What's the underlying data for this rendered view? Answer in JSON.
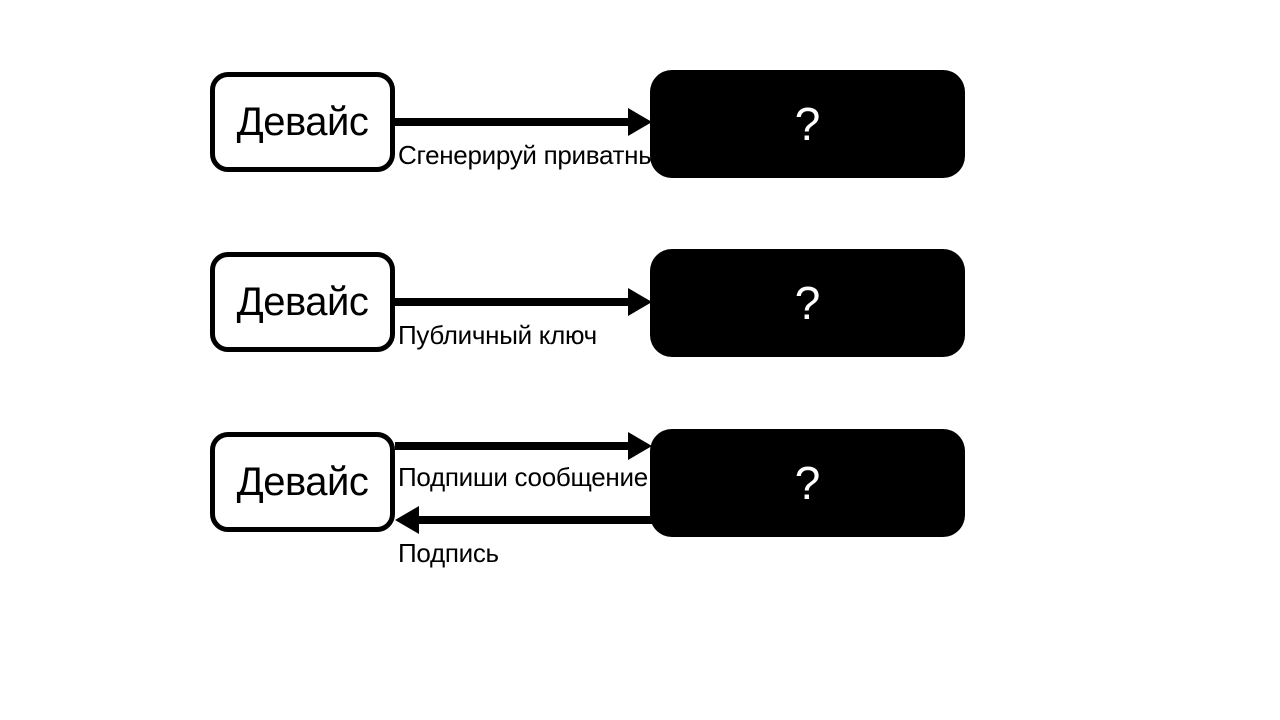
{
  "rows": [
    {
      "device_label": "Девайс",
      "mystery_label": "?",
      "arrows": [
        {
          "direction": "right",
          "caption": "Сгенерируй приватный ключ"
        }
      ]
    },
    {
      "device_label": "Девайс",
      "mystery_label": "?",
      "arrows": [
        {
          "direction": "right",
          "caption": "Публичный ключ"
        }
      ]
    },
    {
      "device_label": "Девайс",
      "mystery_label": "?",
      "arrows": [
        {
          "direction": "right",
          "caption": "Подпиши сообщение"
        },
        {
          "direction": "left",
          "caption": "Подпись"
        }
      ]
    }
  ]
}
